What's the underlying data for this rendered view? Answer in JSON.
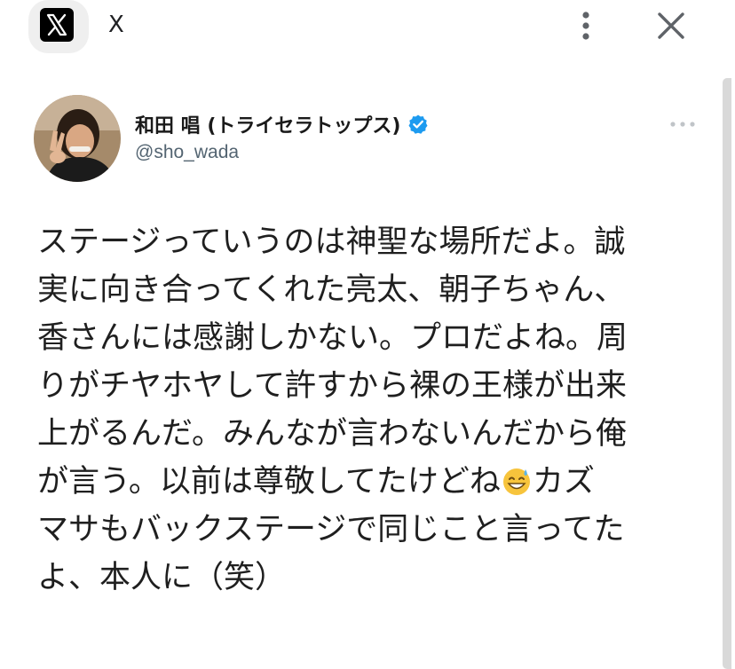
{
  "topbar": {
    "app_icon": "x-logo-icon",
    "title": "X",
    "menu_icon": "kebab-menu-icon",
    "close_icon": "close-icon"
  },
  "tweet": {
    "display_name": "和田 唱 (トライセラトップス)",
    "handle": "@sho_wada",
    "verified_icon": "verified-badge-icon",
    "verified_color": "#1d9bf0",
    "more_icon": "more-horizontal-icon",
    "lines": [
      "ステージっていうのは神聖な場所だよ。誠",
      "実に向き合ってくれた亮太、朝子ちゃん、",
      "香さんには感謝しかない。プロだよね。周",
      "りがチヤホヤして許すから裸の王様が出来",
      "上がるんだ。みんなが言わないんだから俺",
      {
        "before": "が言う。以前は尊敬してたけどね",
        "emoji": "grinning-sweat-emoji",
        "after": "カズ"
      },
      "マサもバックステージで同じこと言ってた",
      "よ、本人に（笑）"
    ]
  }
}
